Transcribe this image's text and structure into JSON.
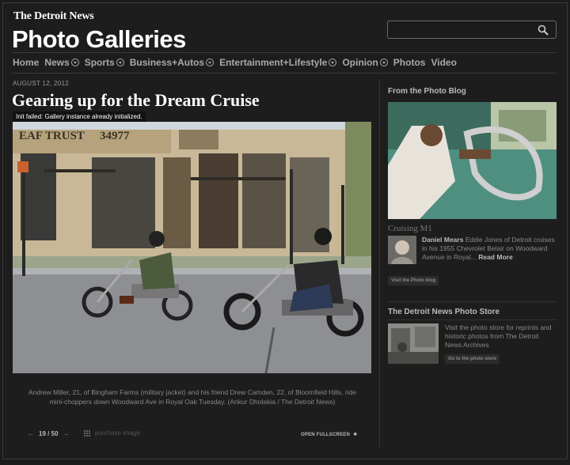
{
  "header": {
    "brand": "The Detroit News",
    "title": "Photo Galleries",
    "search_placeholder": ""
  },
  "nav": [
    {
      "label": "Home",
      "dropdown": false
    },
    {
      "label": "News",
      "dropdown": true
    },
    {
      "label": "Sports",
      "dropdown": true
    },
    {
      "label": "Business+Autos",
      "dropdown": true
    },
    {
      "label": "Entertainment+Lifestyle",
      "dropdown": true
    },
    {
      "label": "Opinion",
      "dropdown": true
    },
    {
      "label": "Photos",
      "dropdown": false
    },
    {
      "label": "Video",
      "dropdown": false
    }
  ],
  "gallery": {
    "date": "AUGUST 12, 2012",
    "title": "Gearing up for the Dream Cruise",
    "error": "Init failed: Gallery instance already initialized.",
    "caption": "Andrew Miller, 21, of Bingham Farms (military jacket) and his friend Drew Camden, 22, of Bloomfield Hills, ride mini-choppers down Woodward Ave in Royal Oak Tuesday. (Ankur Dholakia / The Detroit News)",
    "counter": "19 / 50",
    "purchase_label": "purchase image",
    "fullscreen_label": "OPEN FULLSCREEN"
  },
  "sidebar": {
    "blog_heading": "From the Photo Blog",
    "blog_post_title": "Cruising M1",
    "blog_author": "Daniel Mears",
    "blog_excerpt": "Eddie Jones of Detroit cruises in his 1955 Chevrolet Belair on Woodward Avenue in Royal...",
    "read_more": "Read More",
    "blog_button": "Visit the Photo blog",
    "store_heading": "The Detroit News Photo Store",
    "store_text": "Visit the photo store for reprints and historic photos from The Detroit News Archives",
    "store_button": "Go to the photo store"
  },
  "icons": {
    "search": "search-icon",
    "prev": "arrow-left-icon",
    "next": "arrow-right-icon",
    "grid": "grid-icon",
    "fullscreen": "fullscreen-icon",
    "dropdown": "chevron-down-icon"
  },
  "colors": {
    "background": "#1d1d1d",
    "text": "#cccccc",
    "heading": "#ffffff"
  }
}
